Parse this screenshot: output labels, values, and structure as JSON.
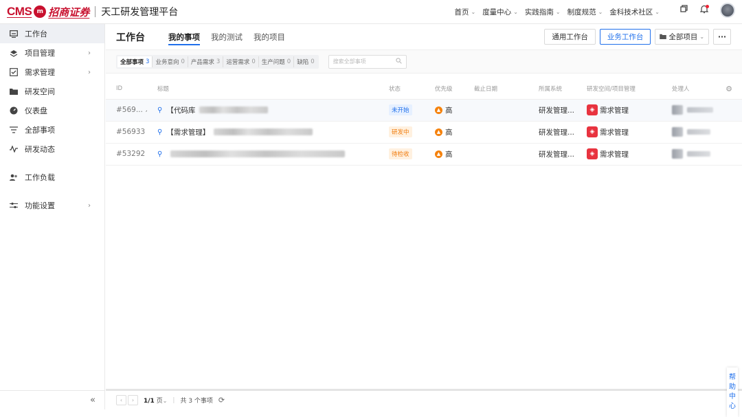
{
  "brand": {
    "cms": "CMS",
    "badge": "m",
    "cn": "招商证券",
    "platform": "天工研发管理平台"
  },
  "topnav": [
    {
      "label": "首页"
    },
    {
      "label": "度量中心"
    },
    {
      "label": "实践指南"
    },
    {
      "label": "制度规范"
    },
    {
      "label": "金科技术社区"
    }
  ],
  "sidebar": {
    "items": [
      {
        "label": "工作台",
        "icon": "monitor-icon"
      },
      {
        "label": "项目管理",
        "icon": "layers-icon"
      },
      {
        "label": "需求管理",
        "icon": "checkbox-icon"
      },
      {
        "label": "研发空间",
        "icon": "folder-icon"
      },
      {
        "label": "仪表盘",
        "icon": "dashboard-icon"
      },
      {
        "label": "全部事项",
        "icon": "filter-icon"
      },
      {
        "label": "研发动态",
        "icon": "activity-icon"
      },
      {
        "label": "工作负载",
        "icon": "users-icon"
      },
      {
        "label": "功能设置",
        "icon": "sliders-icon"
      }
    ],
    "collapse": "«"
  },
  "header": {
    "title": "工作台",
    "tabs": [
      {
        "label": "我的事项"
      },
      {
        "label": "我的测试"
      },
      {
        "label": "我的项目"
      }
    ],
    "btn_general": "通用工作台",
    "btn_business": "业务工作台",
    "btn_projects": "全部项目",
    "btn_more": "···"
  },
  "filters": {
    "tabs": [
      {
        "label": "全部事项",
        "count": "3"
      },
      {
        "label": "业务意向",
        "count": "0"
      },
      {
        "label": "产品需求",
        "count": "3"
      },
      {
        "label": "运营需求",
        "count": "0"
      },
      {
        "label": "生产问题",
        "count": "0"
      },
      {
        "label": "缺陷",
        "count": "0"
      }
    ],
    "search_placeholder": "搜索全部事项"
  },
  "table": {
    "columns": [
      "ID",
      "标题",
      "状态",
      "优先级",
      "截止日期",
      "所属系统",
      "研发空间/项目管理",
      "处理人"
    ],
    "rows": [
      {
        "id": "#569...",
        "title_prefix": "【代码库",
        "status": "未开始",
        "status_bg": "#e6f0ff",
        "status_fg": "#1f6feb",
        "priority": "高",
        "system": "研发管理...",
        "space": "需求管理"
      },
      {
        "id": "#56933",
        "title_prefix": "【需求管理】",
        "status": "研发中",
        "status_bg": "#fff1e0",
        "status_fg": "#f07c0e",
        "priority": "高",
        "system": "研发管理...",
        "space": "需求管理"
      },
      {
        "id": "#53292",
        "title_prefix": "",
        "status": "待检收",
        "status_bg": "#fff1e0",
        "status_fg": "#f07c0e",
        "priority": "高",
        "system": "研发管理...",
        "space": "需求管理"
      }
    ]
  },
  "footer": {
    "page": "1/1",
    "page_unit": "页",
    "total": "共 3 个事项"
  },
  "help": [
    "帮",
    "助",
    "中",
    "心"
  ]
}
